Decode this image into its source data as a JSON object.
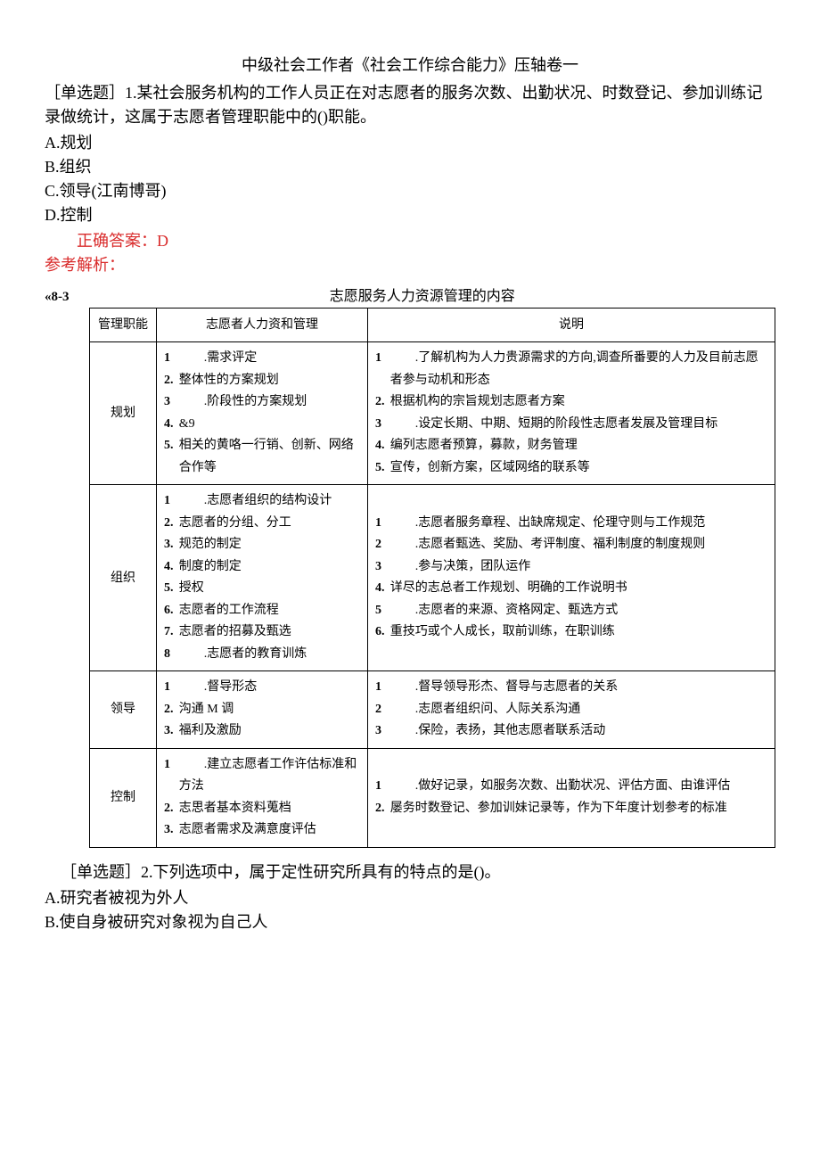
{
  "title": "中级社会工作者《社会工作综合能力》压轴卷一",
  "q1": {
    "stem_prefix": "［单选题］1.",
    "stem": "某社会服务机构的工作人员正在对志愿者的服务次数、出勤状况、时数登记、参加训练记录做统计，这属于志愿者管理职能中的()职能。",
    "options": {
      "A": "A.规划",
      "B": "B.组织",
      "C": "C.领导(江南博哥)",
      "D": "D.控制"
    },
    "answer": "正确答案：D",
    "analysis_label": "参考解析："
  },
  "table": {
    "tag": "«8-3",
    "caption": "志愿服务人力资源管理的内容",
    "headers": {
      "c1": "管理职能",
      "c2": "志愿者人力资和管理",
      "c3": "说明"
    },
    "rows": [
      {
        "func": "规划",
        "hr": [
          {
            "n": "1",
            "nw": true,
            "t": ".需求评定"
          },
          {
            "n": "2.",
            "t": "整体性的方案规划"
          },
          {
            "n": "3",
            "nw": true,
            "t": ".阶段性的方案规划"
          },
          {
            "n": "4.",
            "t": "&9"
          },
          {
            "n": "5.",
            "t": "相关的黄咯一行销、创新、网络合作等"
          }
        ],
        "desc": [
          {
            "n": "1",
            "nw": true,
            "t": ".了解机构为人力贵源需求的方向,调查所番要的人力及目前志愿者参与动机和形态"
          },
          {
            "n": "2.",
            "t": "根据机构的宗旨规划志愿者方案"
          },
          {
            "n": "3",
            "nw": true,
            "t": ".设定长期、中期、短期的阶段性志愿者发展及管理目标"
          },
          {
            "n": "4.",
            "t": "编列志愿者预算，募款，财务管理"
          },
          {
            "n": "5.",
            "t": "宣传，创新方案，区域网络的联系等"
          }
        ]
      },
      {
        "func": "组织",
        "hr": [
          {
            "n": "1",
            "nw": true,
            "t": ".志愿者组织的结构设计"
          },
          {
            "n": "2.",
            "t": "志愿者的分组、分工"
          },
          {
            "n": "3.",
            "t": "规范的制定"
          },
          {
            "n": "4.",
            "t": "制度的制定"
          },
          {
            "n": "5.",
            "t": "授权"
          },
          {
            "n": "6.",
            "t": "志愿者的工作流程"
          },
          {
            "n": "7.",
            "t": "志愿者的招募及甄选"
          },
          {
            "n": "8",
            "nw": true,
            "t": ".志愿者的教育训炼"
          }
        ],
        "desc": [
          {
            "n": "1",
            "nw": true,
            "t": ".志愿者服务章程、出缺席规定、伦理守则与工作规范"
          },
          {
            "n": "2",
            "nw": true,
            "t": ".志愿者甄选、奖励、考评制度、福利制度的制度规则"
          },
          {
            "n": "3",
            "nw": true,
            "t": ".参与决策，团队运作"
          },
          {
            "n": "4.",
            "t": "详尽的志总者工作规划、明确的工作说明书"
          },
          {
            "n": "5",
            "nw": true,
            "t": ".志愿者的来源、资格网定、甄选方式"
          },
          {
            "n": "6.",
            "t": "重技巧或个人成长，取前训练，在职训练"
          }
        ]
      },
      {
        "func": "领导",
        "hr": [
          {
            "n": "1",
            "nw": true,
            "t": ".督导形态"
          },
          {
            "n": "2.",
            "t": "沟通 M 调"
          },
          {
            "n": "3.",
            "t": "福利及激励"
          }
        ],
        "desc": [
          {
            "n": "1",
            "nw": true,
            "t": ".督导领导形杰、督导与志愿者的关系"
          },
          {
            "n": "2",
            "nw": true,
            "t": ".志愿者组织问、人际关系沟通"
          },
          {
            "n": "3",
            "nw": true,
            "t": ".保险，表扬，其他志愿者联系活动"
          }
        ]
      },
      {
        "func": "控制",
        "hr": [
          {
            "n": "1",
            "nw": true,
            "t": ".建立志愿者工作许估标准和方法"
          },
          {
            "n": "2.",
            "t": "志思者基本资料蒐档"
          },
          {
            "n": "3.",
            "t": "志愿者需求及满意度评估"
          }
        ],
        "desc": [
          {
            "n": "1",
            "nw": true,
            "t": ".做好记录，如服务次数、出勤状况、评估方面、由谁评估"
          },
          {
            "n": "2.",
            "t": "屡务时数登记、参加训妹记录等，作为下年度计划参考的标准"
          }
        ]
      }
    ]
  },
  "q2": {
    "stem_prefix": "［单选题］2.",
    "stem": "下列选项中，属于定性研究所具有的特点的是()。",
    "options": {
      "A": "A.研究者被视为外人",
      "B": "B.使自身被研究对象视为自己人"
    }
  }
}
